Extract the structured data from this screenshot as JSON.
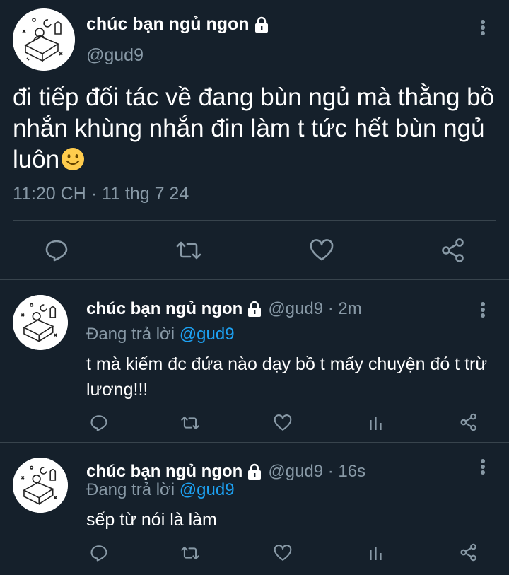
{
  "main_tweet": {
    "display_name": "chúc bạn ngủ ngon",
    "handle": "@gud9",
    "text": "đi tiếp đối tác về đang bùn ngủ mà thằng bồ nhắn khùng nhắn đin làm t tức hết bùn ngủ luôn",
    "timestamp": "11:20 CH · 11 thg 7 24",
    "icons": [
      "lock-icon",
      "more-icon",
      "smile-emoji",
      "reply-icon",
      "retweet-icon",
      "like-icon",
      "share-icon"
    ]
  },
  "replies": [
    {
      "display_name": "chúc bạn ngủ ngon",
      "meta": "@gud9 · 2m",
      "replying_prefix": "Đang trả lời",
      "replying_to": "@gud9",
      "text": "t mà kiếm đc đứa nào dạy bồ t mấy chuyện đó t trừ lương!!!"
    },
    {
      "display_name": "chúc bạn ngủ ngon",
      "meta": "@gud9 · 16s",
      "replying_prefix": "Đang trả lời",
      "replying_to": "@gud9",
      "text": "sếp từ nói là làm"
    }
  ],
  "colors": {
    "background": "#15202b",
    "secondary_text": "#8899a6",
    "link": "#1da1f2",
    "divider": "#38444d"
  }
}
